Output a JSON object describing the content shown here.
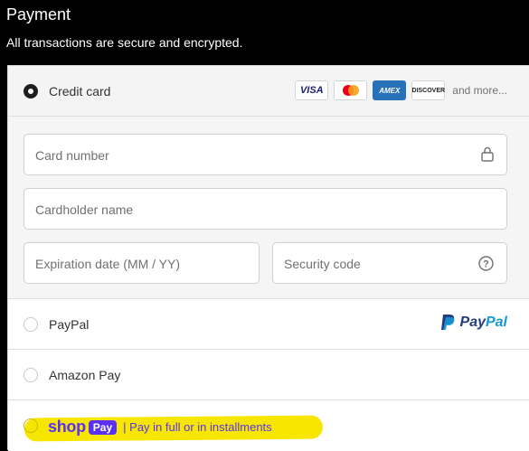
{
  "header": {
    "title": "Payment",
    "subtitle": "All transactions are secure and encrypted."
  },
  "credit_card": {
    "label": "Credit card",
    "selected": true,
    "brands": [
      "VISA",
      "AMEX",
      "DISCOVER"
    ],
    "more_label": "and more...",
    "fields": {
      "card_number": "Card number",
      "cardholder_name": "Cardholder name",
      "expiration": "Expiration date (MM / YY)",
      "security_code": "Security code"
    }
  },
  "methods": {
    "paypal": {
      "label": "PayPal",
      "logo_text": "PayPal"
    },
    "amazon": {
      "label": "Amazon Pay"
    },
    "shop": {
      "word": "shop",
      "pay": "Pay",
      "tagline": "| Pay in full or in installments"
    }
  },
  "colors": {
    "selected_radio": "#1e1e1e",
    "paypal_blue": "#253b80",
    "paypal_light": "#179bd7",
    "shop_purple": "#5a31f4",
    "highlight_yellow": "#f7e600"
  }
}
